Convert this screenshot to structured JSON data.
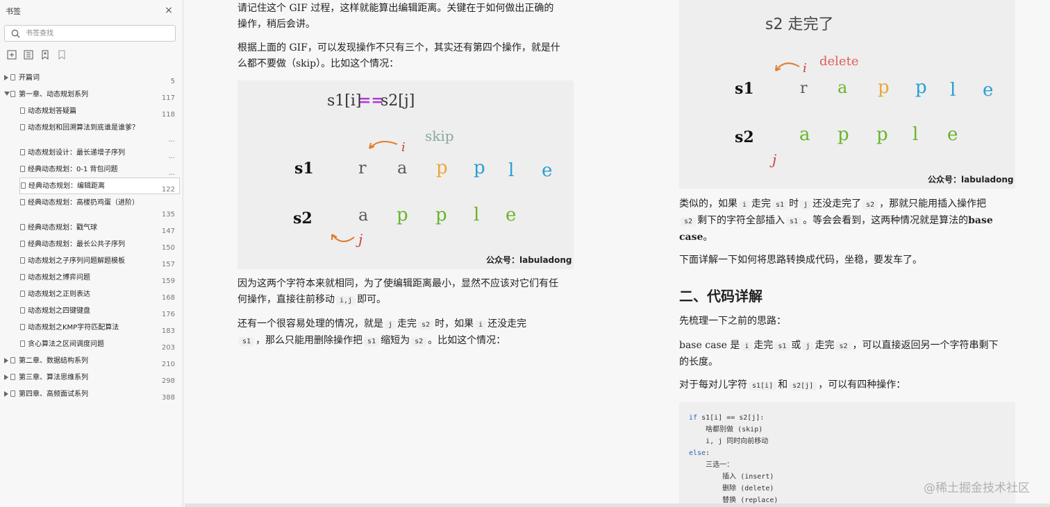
{
  "sidebar": {
    "title": "书签",
    "search_placeholder": "书签查找",
    "items": [
      {
        "label": "开篇词",
        "page": "5",
        "level": 0,
        "expandable": true
      },
      {
        "label": "第一章、动态规划系列",
        "page": "117",
        "level": 0,
        "expandable": true,
        "expanded": true
      },
      {
        "label": "动态规划答疑篇",
        "page": "118",
        "level": 1
      },
      {
        "label": "动态规划和回溯算法到底谁是谁爹？",
        "page": "...",
        "level": 1
      },
      {
        "label": "动态规划设计：最长递增子序列",
        "page": "...",
        "level": 1
      },
      {
        "label": "经典动态规划：0-1 背包问题",
        "page": "...",
        "level": 1
      },
      {
        "label": "经典动态规划：编辑距离",
        "page": "122",
        "level": 1,
        "selected": true
      },
      {
        "label": "经典动态规划：高楼扔鸡蛋（进阶）",
        "page": "135",
        "level": 1
      },
      {
        "label": "经典动态规划：戳气球",
        "page": "147",
        "level": 1
      },
      {
        "label": "经典动态规划：最长公共子序列",
        "page": "150",
        "level": 1
      },
      {
        "label": "动态规划之子序列问题解题模板",
        "page": "157",
        "level": 1
      },
      {
        "label": "动态规划之博弈问题",
        "page": "159",
        "level": 1
      },
      {
        "label": "动态规划之正则表达",
        "page": "168",
        "level": 1
      },
      {
        "label": "动态规划之四键键盘",
        "page": "176",
        "level": 1
      },
      {
        "label": "动态规划之KMP字符匹配算法",
        "page": "183",
        "level": 1
      },
      {
        "label": "贪心算法之区间调度问题",
        "page": "203",
        "level": 1
      },
      {
        "label": "第二章、数据结构系列",
        "page": "210",
        "level": 0,
        "expandable": true
      },
      {
        "label": "第三章、算法思维系列",
        "page": "298",
        "level": 0,
        "expandable": true
      },
      {
        "label": "第四章、高频面试系列",
        "page": "388",
        "level": 0,
        "expandable": true
      }
    ]
  },
  "left": {
    "p1": {
      "l1": "请记住这个 GIF 过程，这样就能算出编辑距离。关键在于如何做出正确的",
      "l2": "操作，稍后会讲。"
    },
    "p2": {
      "l1": "根据上面的 GIF，可以发现操作不只有三个，其实还有第四个操作，就是什",
      "l2": "么都不要做（skip）。比如这个情况："
    },
    "fig": {
      "header_left": "s1[i]",
      "header_op": "==",
      "header_right": "s2[j]",
      "annot": "skip",
      "i": "i",
      "j": "j",
      "row1_label": "s1",
      "row1_chars": [
        "r",
        "a",
        "p",
        "p",
        "l",
        "e"
      ],
      "row2_label": "s2",
      "row2_chars": [
        "a",
        "p",
        "p",
        "l",
        "e"
      ],
      "credit": "公众号：labuladong"
    },
    "p3": {
      "l1": "因为这两个字符本来就相同，为了使编辑距离最小，显然不应该对它们有任",
      "l2a": "何操作，直接往前移动",
      "code1": "i,j",
      "l2b": "即可。"
    },
    "p4": {
      "a": "还有一个很容易处理的情况，就是",
      "c1": "j",
      "b": "走完",
      "c2": "s2",
      "c": "时，如果",
      "c3": "i",
      "d": "还没走完",
      "c4": "s1",
      "e": "，那么只能用删除操作把",
      "c5": "s1",
      "f": "缩短为",
      "c6": "s2",
      "g": "。比如这个情况："
    }
  },
  "right": {
    "fig": {
      "title": "s2 走完了",
      "annot": "delete",
      "i": "i",
      "j": "j",
      "row1_label": "s1",
      "row1_chars": [
        "r",
        "a",
        "p",
        "p",
        "l",
        "e"
      ],
      "row2_label": "s2",
      "row2_chars": [
        "a",
        "p",
        "p",
        "l",
        "e"
      ],
      "credit": "公众号：labuladong"
    },
    "p1": {
      "a": "类似的，如果",
      "c1": "i",
      "b": "走完",
      "c2": "s1",
      "c": "时",
      "c3": "j",
      "d": "还没走完了",
      "c4": "s2",
      "e": "，那就只能用插入操作把",
      "c5": "s2",
      "f": "剩下的字符全部插入",
      "c6": "s1",
      "g": "。等会会看到，这两种情况就是算法的",
      "bold1": "base",
      "bold2": "case",
      "h": "。"
    },
    "p2": "下面详解一下如何将思路转换成代码，坐稳，要发车了。",
    "h2": "二、代码详解",
    "p3": "先梳理一下之前的思路：",
    "p4": {
      "a": "base case 是",
      "c1": "i",
      "b": "走完",
      "c2": "s1",
      "c": "或",
      "c3": "j",
      "d": "走完",
      "c4": "s2",
      "e": "，可以直接返回另一个字符串剩下",
      "f": "的长度。"
    },
    "p5": {
      "a": "对于每对儿字符",
      "c1": "s1[i]",
      "b": "和",
      "c2": "s2[j]",
      "c": "，可以有四种操作："
    },
    "code": {
      "l1_kw": "if",
      "l1": " s1[i] == s2[j]:",
      "l2": "啥都别做 (skip)",
      "l3": "i, j 同时向前移动",
      "l4_kw": "else",
      "l4": ":",
      "l5": "三选一：",
      "l6": "插入 (insert)",
      "l7": "删除 (delete)",
      "l8": "替换 (replace)"
    }
  },
  "watermark": "@稀土掘金技术社区",
  "colors": {
    "r": "#5a5a5a",
    "a": "#6ab42d",
    "p": "#e8a93a",
    "p2": "#2a9fd6",
    "l": "#6ab42d",
    "e": "#2a9fd6",
    "op": "#b23ad6",
    "arrow": "#e07c2c",
    "delete": "#e05a5a",
    "skip": "#8aa89c"
  }
}
